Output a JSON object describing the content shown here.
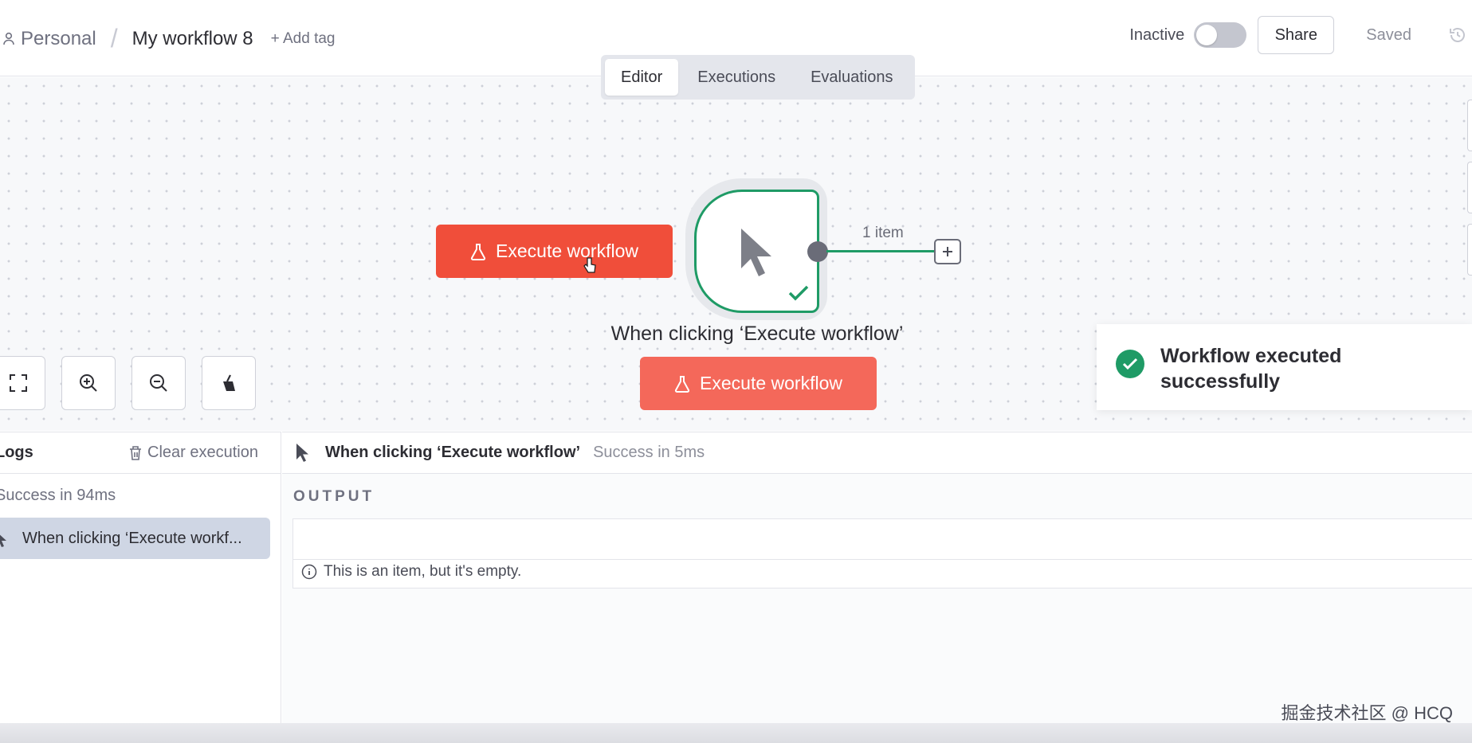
{
  "header": {
    "project": "Personal",
    "separator": "/",
    "workflow_name": "My workflow 8",
    "add_tag": "+ Add tag",
    "status_label": "Inactive",
    "share_label": "Share",
    "saved_label": "Saved"
  },
  "tabs": [
    {
      "label": "Editor",
      "active": true
    },
    {
      "label": "Executions",
      "active": false
    },
    {
      "label": "Evaluations",
      "active": false
    }
  ],
  "canvas": {
    "execute_button_label": "Execute workflow",
    "execute_button_secondary_label": "Execute workflow",
    "node_label": "When clicking ‘Execute workflow’",
    "edge_label": "1 item",
    "toast_message": "Workflow executed successfully"
  },
  "logs": {
    "title": "Logs",
    "clear_label": "Clear execution",
    "status": "Success in 94ms",
    "entries": [
      {
        "label": "When clicking ‘Execute workf..."
      }
    ]
  },
  "output": {
    "node_name": "When clicking ‘Execute workflow’",
    "node_status": "Success in 5ms",
    "section_label": "OUTPUT",
    "empty_message": "This is an item, but it's empty."
  },
  "watermark": "掘金技术社区 @ HCQ",
  "colors": {
    "accent": "#f04e3a",
    "success": "#1f9b66"
  }
}
